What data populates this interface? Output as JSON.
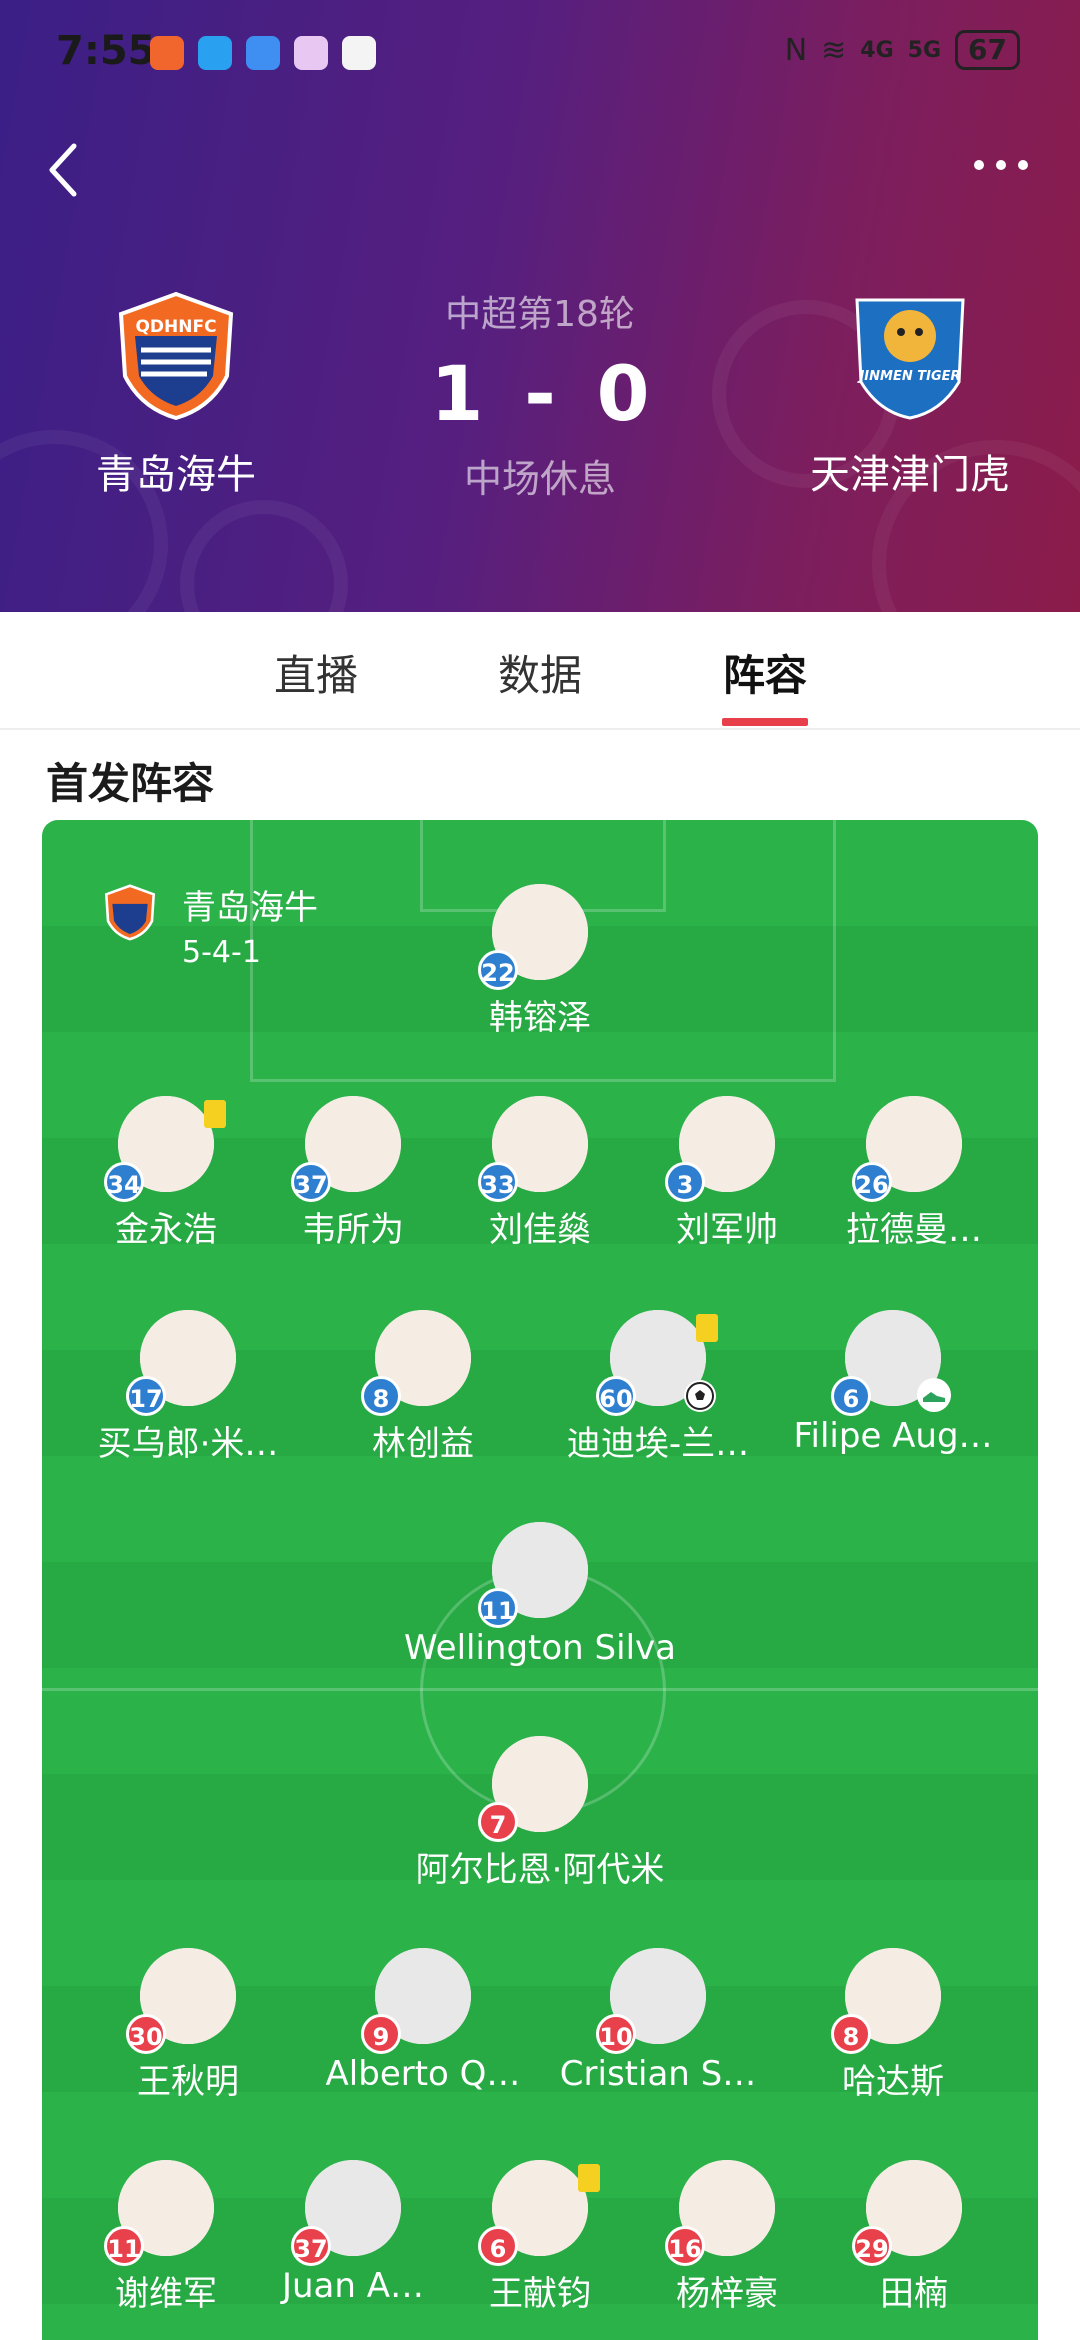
{
  "status_bar": {
    "time": "7:55",
    "signal_1": "4G",
    "signal_2": "5G",
    "battery": "67"
  },
  "match": {
    "competition": "中超第18轮",
    "home_team": "青岛海牛",
    "away_team": "天津津门虎",
    "home_score": "1",
    "separator": "-",
    "away_score": "0",
    "status": "中场休息",
    "home_logo_text": "QDHNFC",
    "away_logo_text": "JINMEN TIGER"
  },
  "tabs": [
    {
      "label": "直播"
    },
    {
      "label": "数据"
    },
    {
      "label": "阵容"
    }
  ],
  "section_title": "首发阵容",
  "lineup": {
    "team_name": "青岛海牛",
    "formation": "5-4-1",
    "home_players": [
      {
        "number": "22",
        "name": "韩镕泽"
      },
      {
        "number": "34",
        "name": "金永浩"
      },
      {
        "number": "37",
        "name": "韦所为"
      },
      {
        "number": "33",
        "name": "刘佳燊"
      },
      {
        "number": "3",
        "name": "刘军帅"
      },
      {
        "number": "26",
        "name": "拉德曼…"
      },
      {
        "number": "17",
        "name": "买乌郎·米…"
      },
      {
        "number": "8",
        "name": "林创益"
      },
      {
        "number": "60",
        "name": "迪迪埃-兰…"
      },
      {
        "number": "6",
        "name": "Filipe Aug…"
      },
      {
        "number": "11",
        "name": "Wellington Silva"
      }
    ],
    "away_players": [
      {
        "number": "7",
        "name": "阿尔比恩·阿代米"
      },
      {
        "number": "30",
        "name": "王秋明"
      },
      {
        "number": "9",
        "name": "Alberto Q…"
      },
      {
        "number": "10",
        "name": "Cristian S…"
      },
      {
        "number": "8",
        "name": "哈达斯"
      },
      {
        "number": "11",
        "name": "谢维军"
      },
      {
        "number": "37",
        "name": "Juan A…"
      },
      {
        "number": "6",
        "name": "王献钧"
      },
      {
        "number": "16",
        "name": "杨梓豪"
      },
      {
        "number": "29",
        "name": "田楠"
      }
    ]
  },
  "colors": {
    "home_number": "#2f7fd1",
    "away_number": "#e8414c",
    "pitch": "#2bb34a",
    "tab_accent": "#e8404a",
    "yellow_card": "#f5d020"
  }
}
